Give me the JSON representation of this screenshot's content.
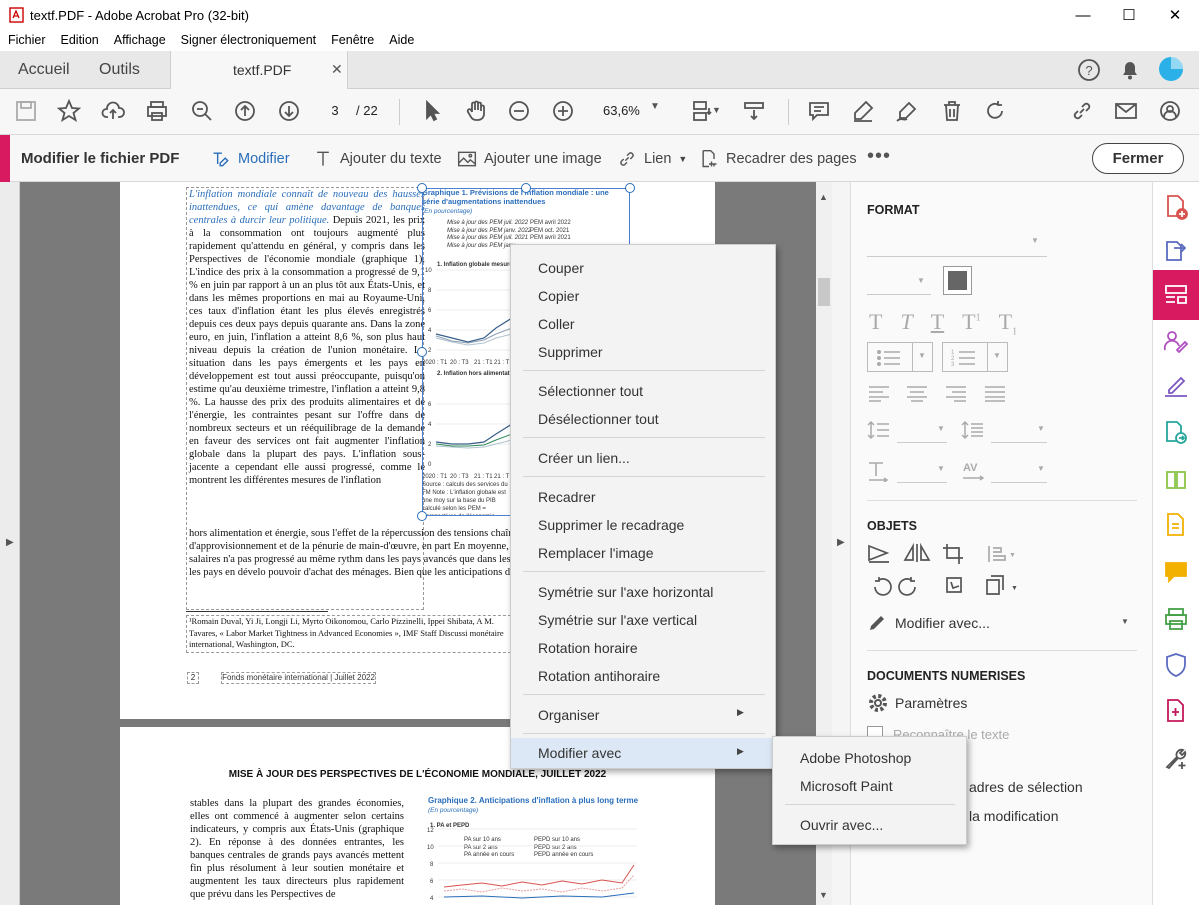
{
  "window": {
    "title": "textf.PDF - Adobe Acrobat Pro (32-bit)"
  },
  "menu": [
    "Fichier",
    "Edition",
    "Affichage",
    "Signer électroniquement",
    "Fenêtre",
    "Aide"
  ],
  "tabs": {
    "home": "Accueil",
    "tools": "Outils",
    "document": "textf.PDF"
  },
  "toolbar": {
    "page_current": "3",
    "page_total": "/ 22",
    "zoom": "63,6%"
  },
  "editbar": {
    "title": "Modifier le fichier PDF",
    "modify": "Modifier",
    "add_text": "Ajouter du texte",
    "add_image": "Ajouter une image",
    "link": "Lien",
    "crop": "Recadrer des pages",
    "close": "Fermer"
  },
  "format_panel": {
    "format_heading": "FORMAT",
    "objects_heading": "OBJETS",
    "edit_with": "Modifier avec...",
    "scanned_heading": "DOCUMENTS NUMERISES",
    "settings": "Paramètres",
    "recognize": "Reconnaître le texte",
    "bounding": "adres de sélection",
    "modification": "la modification"
  },
  "context_menu": {
    "items": [
      "Couper",
      "Copier",
      "Coller",
      "Supprimer",
      "Sélectionner tout",
      "Désélectionner tout",
      "Créer un lien...",
      "Recadrer",
      "Supprimer le recadrage",
      "Remplacer l'image",
      "Symétrie sur l'axe horizontal",
      "Symétrie sur l'axe vertical",
      "Rotation horaire",
      "Rotation antihoraire",
      "Organiser",
      "Modifier avec"
    ]
  },
  "submenu": {
    "items": [
      "Adobe Photoshop",
      "Microsoft Paint",
      "Ouvrir avec..."
    ]
  },
  "doc": {
    "p1_intro": "L'inflation mondiale connaît de nouveau des hausses inattendues, ce qui amène davantage de banques centrales à durcir leur politique.",
    "p1_body": "Depuis 2021, les prix à la consommation ont toujours augmenté plus rapidement qu'attendu en général, y compris dans les Perspectives de l'économie mondiale (graphique 1). L'indice des prix à la consommation a progressé de 9,1 % en juin par rapport à un an plus tôt aux États-Unis, et dans les mêmes proportions en mai au Royaume-Uni, ces taux d'inflation étant les plus élevés enregistrés depuis ces deux pays depuis quarante ans. Dans la zone euro, en juin, l'inflation a atteint 8,6 %, son plus haut niveau depuis la création de l'union monétaire. La situation dans les pays émergents et les pays en développement est tout aussi préoccupante, puisqu'on estime qu'au deuxième trimestre, l'inflation a atteint 9,8 %. La hausse des prix des produits alimentaires et de l'énergie, les contraintes pesant sur l'offre dans de nombreux secteurs et un rééquilibrage de la demande en faveur des services ont fait augmenter l'inflation globale dans la plupart des pays. L'inflation sous-jacente a cependant elle aussi progressé, comme le montrent les différentes mesures de l'inflation",
    "p1_wide": "hors alimentation et énergie, sous l'effet de la répercussion des tensions chaînes d'approvisionnement et de la pénurie de main-d'œuvre, en part En moyenne, la croissance des salaires n'a pas progressé au même rythm dans les pays avancés que dans les pays émergents et les pays en dévelo pouvoir d'achat des ménages. Bien que les anticipations d'inflation à lon",
    "footnote": "¹Romain Duval, Yi Ji, Longji Li, Myrto Oikonomou, Carlo Pizzinelli, Ippei Shibata, A M. Tavares, « Labor Market Tightness in Advanced Economies », IMF Staff Discussi monétaire international, Washington, DC.",
    "page_num": "2",
    "footer": "Fonds monétaire international | Juillet 2022",
    "chart1_title": "Graphique 1.  Prévisions de l'inflation mondiale : une série d'augmentations inattendues",
    "chart1_sub": "(En pourcentage)",
    "chart1_panel1": "1. Inflation globale mesuré",
    "chart1_panel2": "2. Inflation hors alimentat",
    "chart1_source": "Source : calculs des services du FM Note : L'inflation globale est une moy sur la base du PIB calculé selon les PEM = Perspectives de l'économie",
    "legend1": [
      "Mise à jour des PEM juil. 2022",
      "Mise à jour des PEM janv. 2022",
      "Mise à jour des PEM juil. 2021",
      "Mise à jour des PEM janv."
    ],
    "legend2": [
      "PEM avril 2022",
      "PEM oct. 2021",
      "PEM avril 2021"
    ],
    "p2_heading": "MISE À JOUR DES PERSPECTIVES DE L'ÉCONOMIE MONDIALE, JUILLET 2022",
    "p2_body": "stables dans la plupart des grandes économies, elles ont commencé à augmenter selon certains indicateurs, y compris aux États-Unis (graphique 2). En réponse à des données entrantes, les banques centrales de grands pays avancés mettent fin plus résolument à leur soutien monétaire et augmentent les taux directeurs plus rapidement que prévu dans les Perspectives de",
    "chart2_title": "Graphique 2.  Anticipations d'inflation à plus long terme",
    "chart2_sub": "(En pourcentage)",
    "chart2_panel": "1. PA et PEPD",
    "legend3": [
      "PA sur 10 ans",
      "PA sur 2 ans",
      "PA année en cours"
    ],
    "legend4": [
      "PEPD sur 10 ans",
      "PEPD sur 2 ans",
      "PEPD année en cours"
    ]
  },
  "colors": {
    "accent": "#d81b60",
    "blue": "#2a6ebb"
  }
}
